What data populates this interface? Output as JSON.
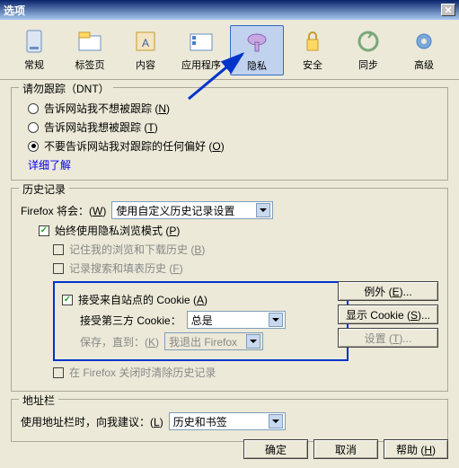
{
  "title": "选项",
  "tabs": [
    {
      "label": "常规"
    },
    {
      "label": "标签页"
    },
    {
      "label": "内容"
    },
    {
      "label": "应用程序"
    },
    {
      "label": "隐私"
    },
    {
      "label": "安全"
    },
    {
      "label": "同步"
    },
    {
      "label": "高级"
    }
  ],
  "dnt": {
    "legend": "请勿跟踪（DNT）",
    "opt1": "告诉网站我不想被跟踪 (",
    "opt1k": "N",
    "opt2": "告诉网站我想被跟踪 (",
    "opt2k": "T",
    "opt3": "不要告诉网站我对跟踪的任何偏好 (",
    "opt3k": "O",
    "learn": "详细了解"
  },
  "history": {
    "legend": "历史记录",
    "prefix": "Firefox 将会：(",
    "prefixk": "W",
    "mode": "使用自定义历史记录设置",
    "private": "始终使用隐私浏览模式 (",
    "privatek": "P",
    "remember": "记住我的浏览和下载历史 (",
    "rememberk": "B",
    "search": "记录搜索和填表历史 (",
    "searchk": "F",
    "cookie": "接受来自站点的 Cookie (",
    "cookiek": "A",
    "third": "接受第三方 Cookie：",
    "thirdVal": "总是",
    "keep": "保存，直到：(",
    "keepk": "K",
    "keepVal": "我退出 Firefox",
    "clear": "在 Firefox 关闭时清除历史记录",
    "exceptions": "例外 (",
    "exceptionsk": "E",
    "show": "显示 Cookie (",
    "showk": "S",
    "settings": "设置 (",
    "settingsk": "T"
  },
  "location": {
    "legend": "地址栏",
    "label": "使用地址栏时，向我建议：(",
    "labelk": "L",
    "value": "历史和书签"
  },
  "buttons": {
    "ok": "确定",
    "cancel": "取消",
    "help": "帮助 (",
    "helpk": "H"
  }
}
